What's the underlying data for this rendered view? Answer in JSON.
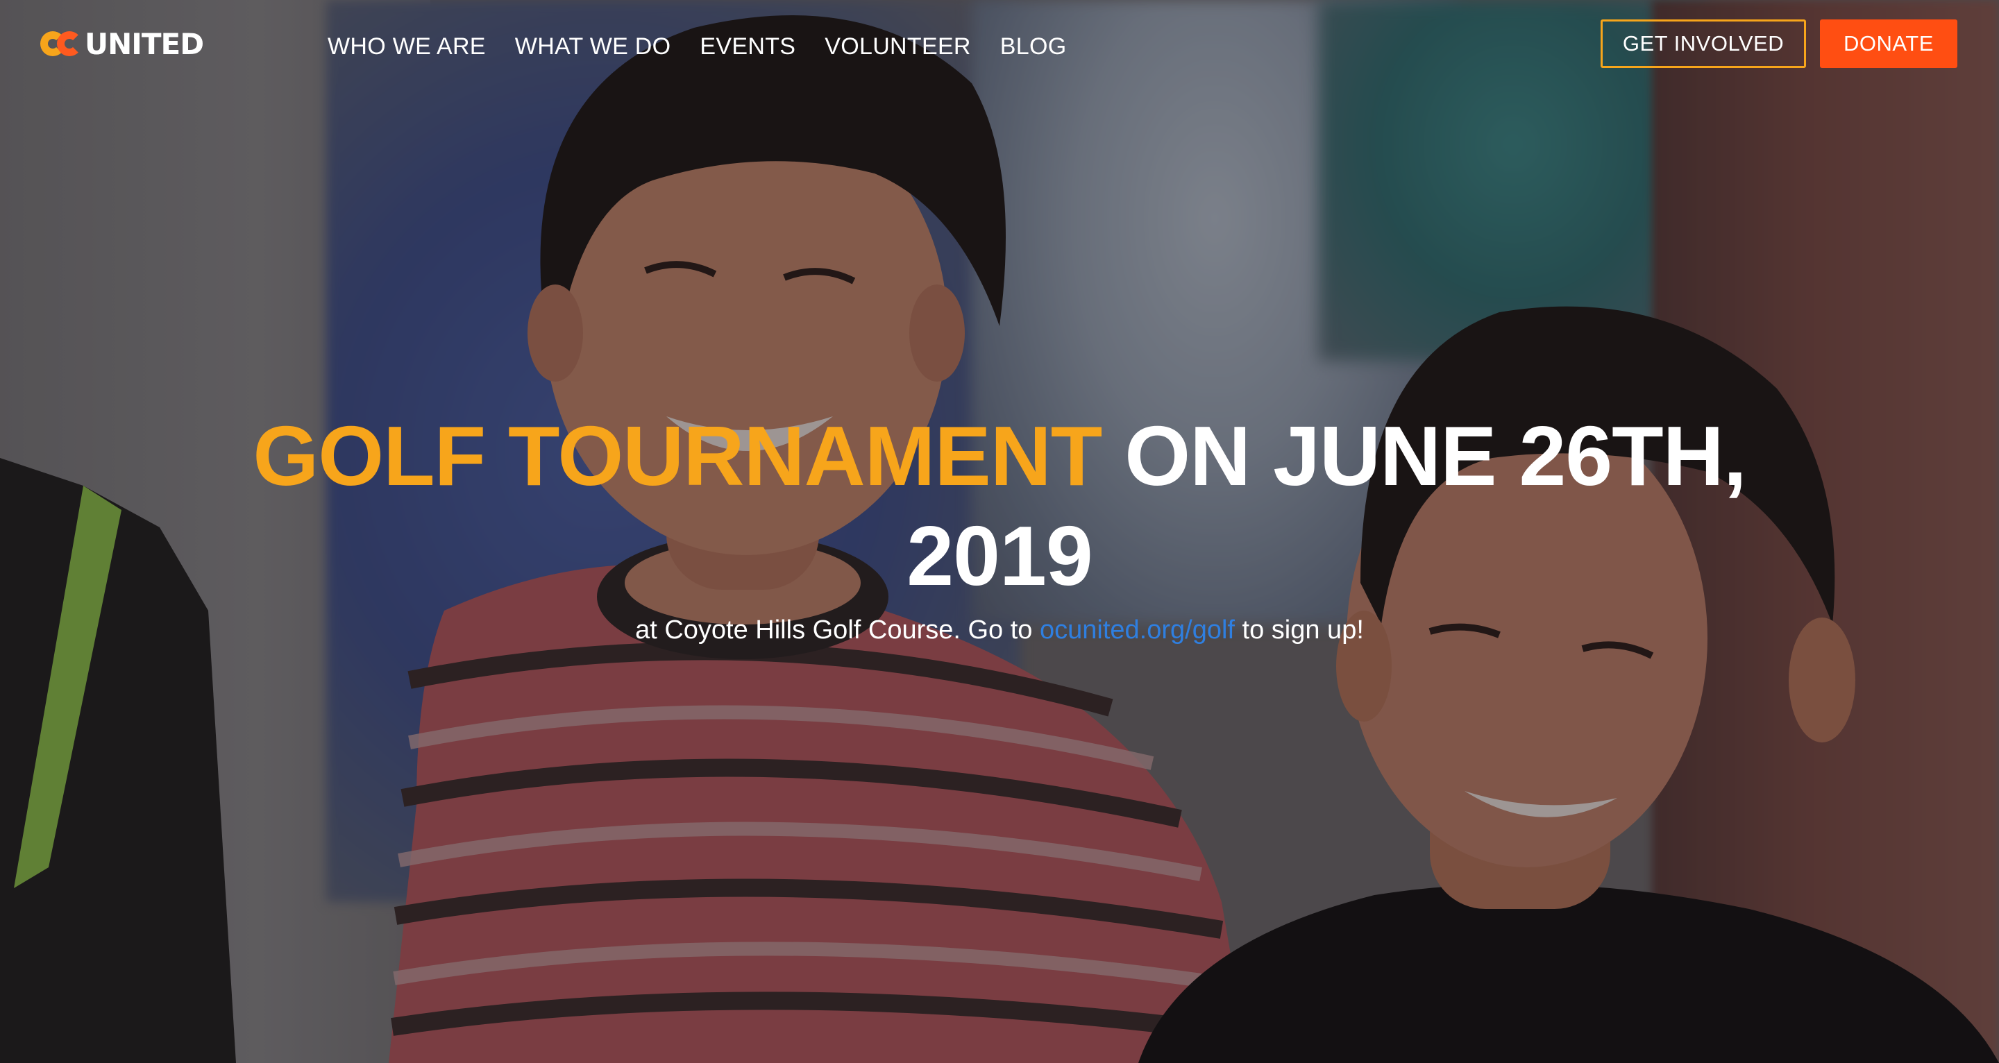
{
  "brand": {
    "logo_text": "UNITED",
    "logo_mark_label": "OC",
    "colors": {
      "accent_orange": "#f7a51b",
      "donate_red": "#ff4e12",
      "link_blue": "#2f7fe0"
    }
  },
  "nav": {
    "items": [
      {
        "label": "WHO WE ARE"
      },
      {
        "label": "WHAT WE DO"
      },
      {
        "label": "EVENTS"
      },
      {
        "label": "VOLUNTEER"
      },
      {
        "label": "BLOG"
      }
    ],
    "get_involved_label": "GET INVOLVED",
    "donate_label": "DONATE"
  },
  "hero": {
    "title_accent": "GOLF TOURNAMENT",
    "title_rest": " ON JUNE 26TH, 2019",
    "subtitle_before": "at Coyote Hills Golf Course. Go to ",
    "subtitle_link": "ocunited.org/golf",
    "subtitle_after": " to sign up!",
    "background_image": "smiling-children-photo"
  }
}
